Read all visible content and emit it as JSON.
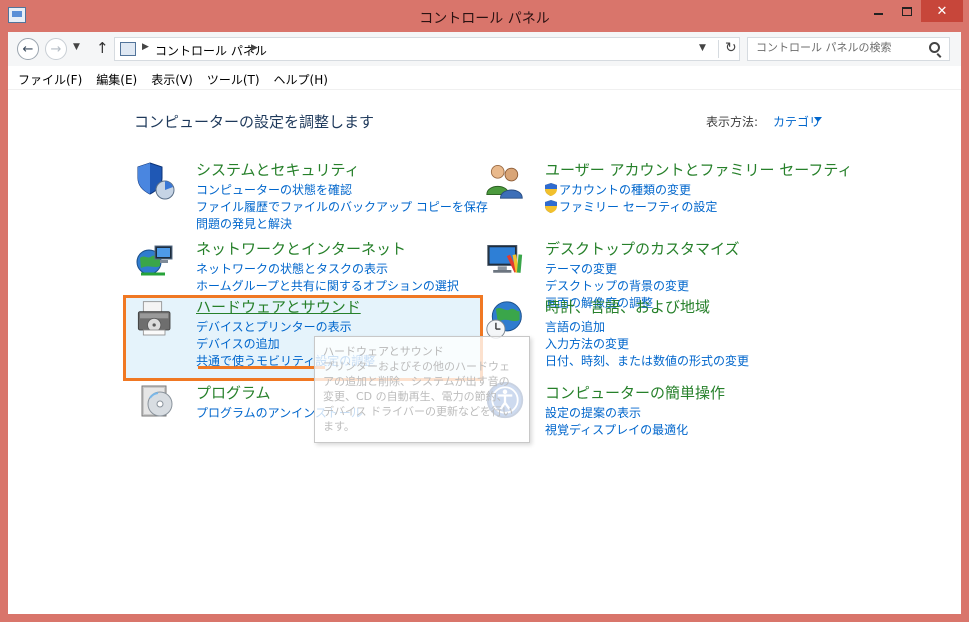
{
  "window": {
    "title": "コントロール パネル"
  },
  "address": {
    "crumb": "コントロール パネル"
  },
  "search": {
    "placeholder": "コントロール パネルの検索"
  },
  "menu": [
    "ファイル(F)",
    "編集(E)",
    "表示(V)",
    "ツール(T)",
    "ヘルプ(H)"
  ],
  "heading": "コンピューターの設定を調整します",
  "view": {
    "label": "表示方法:",
    "value": "カテゴリ"
  },
  "categories": {
    "system": {
      "title": "システムとセキュリティ",
      "links": [
        "コンピューターの状態を確認",
        "ファイル履歴でファイルのバックアップ コピーを保存",
        "問題の発見と解決"
      ],
      "icon": "shield-icon"
    },
    "network": {
      "title": "ネットワークとインターネット",
      "links": [
        "ネットワークの状態とタスクの表示",
        "ホームグループと共有に関するオプションの選択"
      ],
      "icon": "network-globe-icon"
    },
    "hardware": {
      "title": "ハードウェアとサウンド",
      "links": [
        "デバイスとプリンターの表示",
        "デバイスの追加",
        "共通で使うモビリティ設定の調整"
      ],
      "icon": "printer-icon"
    },
    "programs": {
      "title": "プログラム",
      "links": [
        "プログラムのアンインストール"
      ],
      "icon": "programs-disc-icon"
    },
    "users": {
      "title": "ユーザー アカウントとファミリー セーフティ",
      "links": [
        "アカウントの種類の変更",
        "ファミリー セーフティの設定"
      ],
      "icon": "users-icon"
    },
    "appearance": {
      "title": "デスクトップのカスタマイズ",
      "links": [
        "テーマの変更",
        "デスクトップの背景の変更",
        "画面の解像度の調整"
      ],
      "icon": "monitor-paint-icon"
    },
    "clock": {
      "title": "時計、言語、および地域",
      "links": [
        "言語の追加",
        "入力方法の変更",
        "日付、時刻、または数値の形式の変更"
      ],
      "icon": "globe-clock-icon"
    },
    "ease": {
      "title": "コンピューターの簡単操作",
      "links": [
        "設定の提案の表示",
        "視覚ディスプレイの最適化"
      ],
      "icon": "ease-of-access-icon"
    }
  },
  "tooltip": {
    "title": "ハードウェアとサウンド",
    "body": "プリンターおよびその他のハードウェアの追加と削除、システムが出す音の変更、CD の自動再生、電力の節約、デバイス ドライバーの更新などを行います。"
  },
  "colors": {
    "title_bar": "#d9756b",
    "category_title": "#26802a",
    "link": "#0066cc",
    "highlight_border": "#f07823",
    "highlight_fill": "#e5f3fb"
  }
}
